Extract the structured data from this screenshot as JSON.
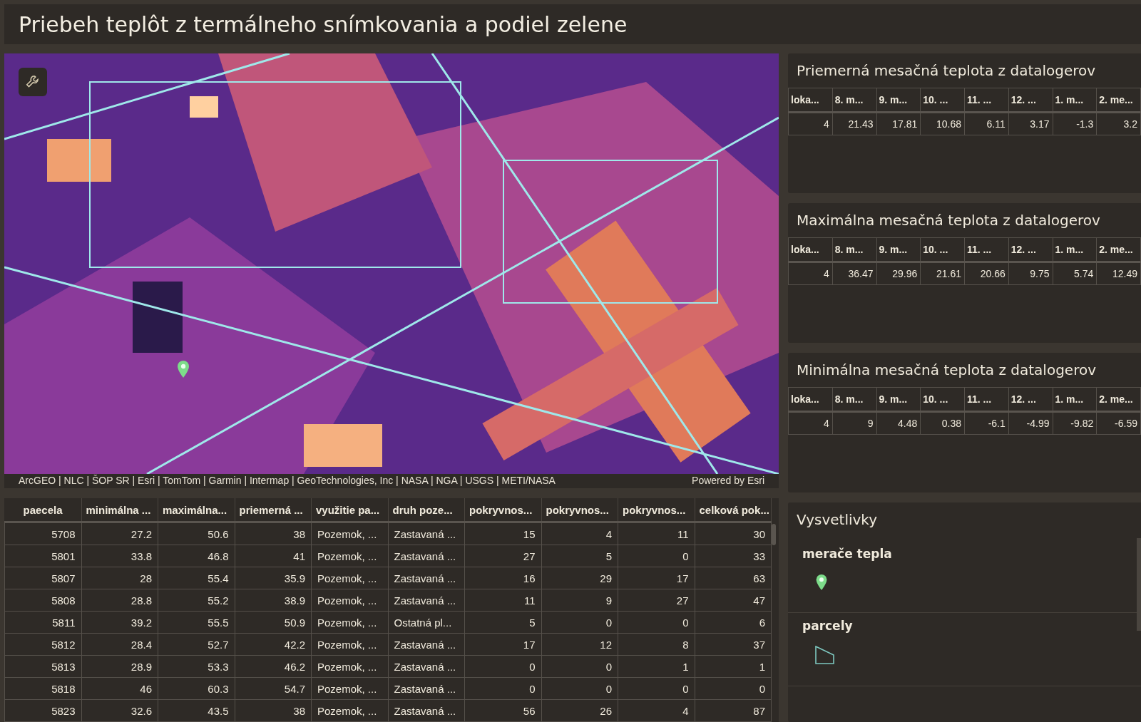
{
  "header": {
    "title": "Priebeh teplôt z termálneho snímkovania a podiel zelene"
  },
  "map": {
    "attribution": "ArcGEO | NLC | ŠOP SR | Esri | TomTom | Garmin | Intermap | GeoTechnologies, Inc | NASA | NGA | USGS | METI/NASA",
    "powered_by": "Powered by Esri"
  },
  "parcel_table": {
    "columns": [
      "paecela",
      "minimálna ...",
      "maximálna...",
      "priemerná ...",
      "využitie pa...",
      "druh poze...",
      "pokryvnos...",
      "pokryvnos...",
      "pokryvnos...",
      "celková pok..."
    ],
    "rows": [
      [
        "5708",
        "27.2",
        "50.6",
        "38",
        "Pozemok, ...",
        "Zastavaná ...",
        "15",
        "4",
        "11",
        "30"
      ],
      [
        "5801",
        "33.8",
        "46.8",
        "41",
        "Pozemok, ...",
        "Zastavaná ...",
        "27",
        "5",
        "0",
        "33"
      ],
      [
        "5807",
        "28",
        "55.4",
        "35.9",
        "Pozemok, ...",
        "Zastavaná ...",
        "16",
        "29",
        "17",
        "63"
      ],
      [
        "5808",
        "28.8",
        "55.2",
        "38.9",
        "Pozemok, ...",
        "Zastavaná ...",
        "11",
        "9",
        "27",
        "47"
      ],
      [
        "5811",
        "39.2",
        "55.5",
        "50.9",
        "Pozemok, ...",
        "Ostatná pl...",
        "5",
        "0",
        "0",
        "6"
      ],
      [
        "5812",
        "28.4",
        "52.7",
        "42.2",
        "Pozemok, ...",
        "Zastavaná ...",
        "17",
        "12",
        "8",
        "37"
      ],
      [
        "5813",
        "28.9",
        "53.3",
        "46.2",
        "Pozemok, ...",
        "Zastavaná ...",
        "0",
        "0",
        "1",
        "1"
      ],
      [
        "5818",
        "46",
        "60.3",
        "54.7",
        "Pozemok, ...",
        "Zastavaná ...",
        "0",
        "0",
        "0",
        "0"
      ],
      [
        "5823",
        "32.6",
        "43.5",
        "38",
        "Pozemok, ...",
        "Zastavaná ...",
        "56",
        "26",
        "4",
        "87"
      ]
    ]
  },
  "logger_tables": [
    {
      "title": "Priemerná mesačná teplota z datalogerov",
      "columns": [
        "loka...",
        "8. m...",
        "9. m...",
        "10. ...",
        "11. ...",
        "12. ...",
        "1. m...",
        "2. me..."
      ],
      "rows": [
        [
          "4",
          "21.43",
          "17.81",
          "10.68",
          "6.11",
          "3.17",
          "-1.3",
          "3.2"
        ]
      ]
    },
    {
      "title": "Maximálna mesačná teplota z datalogerov",
      "columns": [
        "loka...",
        "8. m...",
        "9. m...",
        "10. ...",
        "11. ...",
        "12. ...",
        "1. m...",
        "2. me..."
      ],
      "rows": [
        [
          "4",
          "36.47",
          "29.96",
          "21.61",
          "20.66",
          "9.75",
          "5.74",
          "12.49"
        ]
      ]
    },
    {
      "title": "Minimálna mesačná teplota z datalogerov",
      "columns": [
        "loka...",
        "8. m...",
        "9. m...",
        "10. ...",
        "11. ...",
        "12. ...",
        "1. m...",
        "2. me..."
      ],
      "rows": [
        [
          "4",
          "9",
          "4.48",
          "0.38",
          "-6.1",
          "-4.99",
          "-9.82",
          "-6.59"
        ]
      ]
    }
  ],
  "legend": {
    "title": "Vysvetlivky",
    "layers": [
      {
        "label": "merače tepla",
        "kind": "pin"
      },
      {
        "label": "parcely",
        "kind": "polygon"
      }
    ]
  }
}
